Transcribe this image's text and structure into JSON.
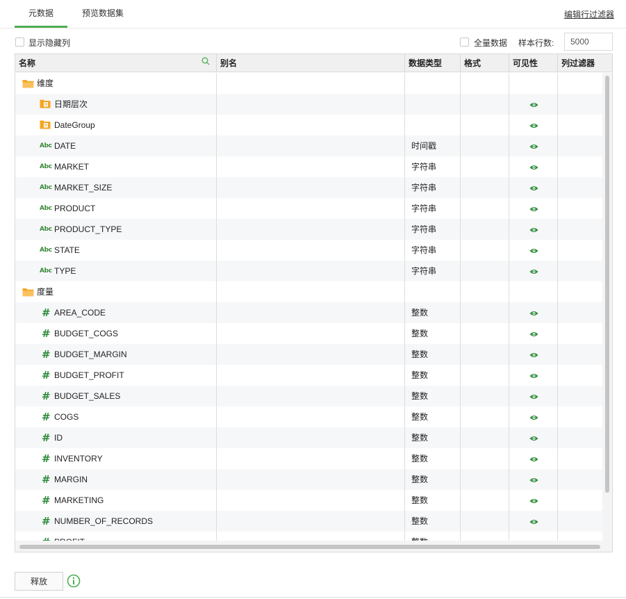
{
  "tabs": [
    {
      "label": "元数据",
      "active": true
    },
    {
      "label": "预览数据集",
      "active": false
    }
  ],
  "edit_filter_label": "编辑行过滤器",
  "options": {
    "show_hidden_label": "显示隐藏列",
    "all_data_label": "全量数据",
    "sample_rows_label": "样本行数:",
    "sample_rows_value": "5000"
  },
  "columns": [
    "名称",
    "别名",
    "数据类型",
    "格式",
    "可见性",
    "列过滤器"
  ],
  "rows": [
    {
      "kind": "folder",
      "name": "维度",
      "type": "",
      "visible": false
    },
    {
      "kind": "datefolder",
      "name": "日期层次",
      "type": "",
      "visible": true
    },
    {
      "kind": "datefolder",
      "name": "DateGroup",
      "type": "",
      "visible": true
    },
    {
      "kind": "abc",
      "name": "DATE",
      "type": "时间戳",
      "visible": true
    },
    {
      "kind": "abc",
      "name": "MARKET",
      "type": "字符串",
      "visible": true
    },
    {
      "kind": "abc",
      "name": "MARKET_SIZE",
      "type": "字符串",
      "visible": true
    },
    {
      "kind": "abc",
      "name": "PRODUCT",
      "type": "字符串",
      "visible": true
    },
    {
      "kind": "abc",
      "name": "PRODUCT_TYPE",
      "type": "字符串",
      "visible": true
    },
    {
      "kind": "abc",
      "name": "STATE",
      "type": "字符串",
      "visible": true
    },
    {
      "kind": "abc",
      "name": "TYPE",
      "type": "字符串",
      "visible": true
    },
    {
      "kind": "folder",
      "name": "度量",
      "type": "",
      "visible": false
    },
    {
      "kind": "hash",
      "name": "AREA_CODE",
      "type": "整数",
      "visible": true
    },
    {
      "kind": "hash",
      "name": "BUDGET_COGS",
      "type": "整数",
      "visible": true
    },
    {
      "kind": "hash",
      "name": "BUDGET_MARGIN",
      "type": "整数",
      "visible": true
    },
    {
      "kind": "hash",
      "name": "BUDGET_PROFIT",
      "type": "整数",
      "visible": true
    },
    {
      "kind": "hash",
      "name": "BUDGET_SALES",
      "type": "整数",
      "visible": true
    },
    {
      "kind": "hash",
      "name": "COGS",
      "type": "整数",
      "visible": true
    },
    {
      "kind": "hash",
      "name": "ID",
      "type": "整数",
      "visible": true
    },
    {
      "kind": "hash",
      "name": "INVENTORY",
      "type": "整数",
      "visible": true
    },
    {
      "kind": "hash",
      "name": "MARGIN",
      "type": "整数",
      "visible": true
    },
    {
      "kind": "hash",
      "name": "MARKETING",
      "type": "整数",
      "visible": true
    },
    {
      "kind": "hash",
      "name": "NUMBER_OF_RECORDS",
      "type": "整数",
      "visible": true
    },
    {
      "kind": "hash",
      "name": "PROFIT",
      "type": "整数",
      "visible": true
    }
  ],
  "release_label": "释放",
  "colors": {
    "accent": "#4caf50",
    "icon_green": "#2e8b3a",
    "folder": "#f5a623"
  }
}
